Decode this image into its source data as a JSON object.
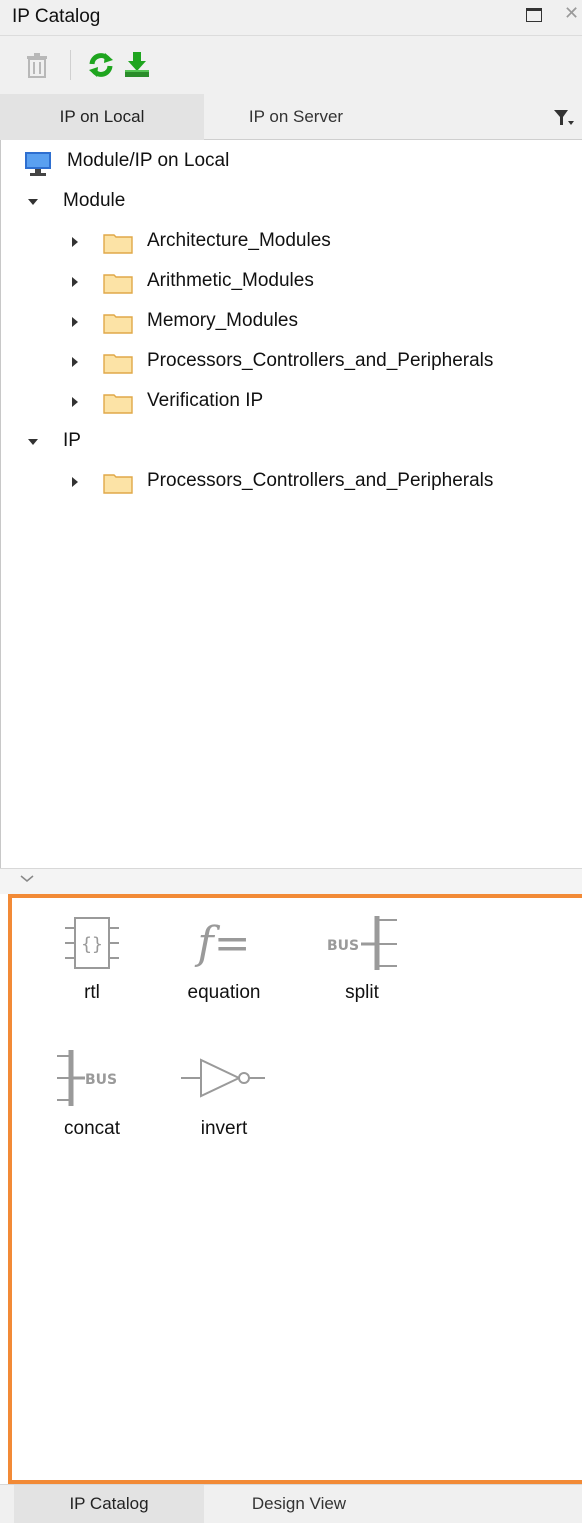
{
  "window": {
    "title": "IP Catalog"
  },
  "toolbar": {
    "buttons": [
      "trash-icon",
      "refresh-icon",
      "download-icon"
    ]
  },
  "tabs": [
    {
      "label": "IP on Local",
      "active": true
    },
    {
      "label": "IP on Server",
      "active": false
    }
  ],
  "tree": {
    "root": "Module/IP on Local",
    "groups": [
      {
        "label": "Module",
        "children": [
          "Architecture_Modules",
          "Arithmetic_Modules",
          "Memory_Modules",
          "Processors_Controllers_and_Peripherals",
          "Verification IP"
        ]
      },
      {
        "label": "IP",
        "children": [
          "Processors_Controllers_and_Peripherals"
        ]
      }
    ]
  },
  "components": {
    "items": [
      {
        "label": "rtl",
        "icon": "rtl-icon",
        "bus_text": ""
      },
      {
        "label": "equation",
        "icon": "equation-icon",
        "bus_text": ""
      },
      {
        "label": "split",
        "icon": "split-icon",
        "bus_text": "BUS"
      },
      {
        "label": "concat",
        "icon": "concat-icon",
        "bus_text": "BUS"
      },
      {
        "label": "invert",
        "icon": "invert-icon",
        "bus_text": ""
      }
    ],
    "equation_glyph": "f=",
    "rtl_glyph": "{}"
  },
  "bottom_tabs": [
    {
      "label": "IP Catalog",
      "active": true
    },
    {
      "label": "Design View",
      "active": false
    }
  ],
  "colors": {
    "accent_border": "#f28a36",
    "folder_fill": "#fce3a6",
    "folder_stroke": "#e0a848",
    "refresh_green": "#1fa51f",
    "icon_gray": "#9a9a9a"
  }
}
